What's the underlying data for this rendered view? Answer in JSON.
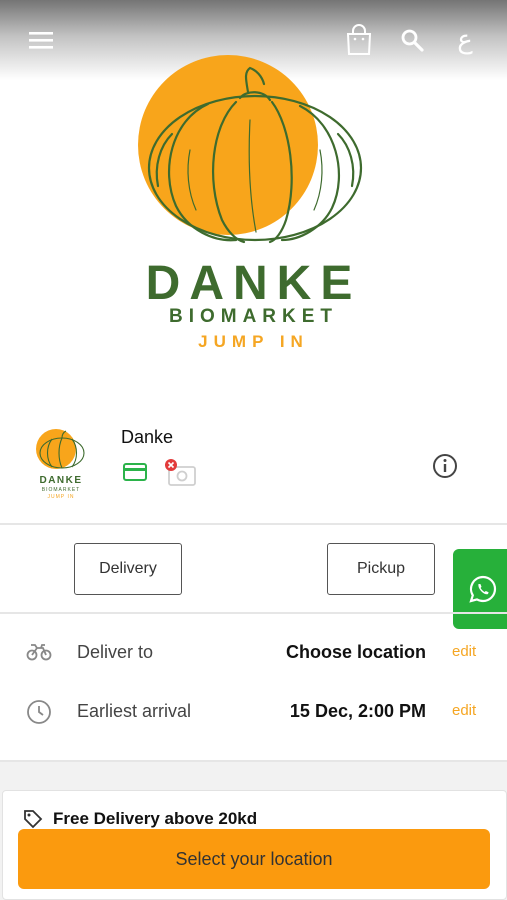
{
  "header": {
    "menu_icon": "hamburger-menu-icon",
    "bag_icon": "shopping-bag-icon",
    "search_icon": "search-icon",
    "language_toggle": "ع"
  },
  "hero": {
    "brand_name": "DANKE",
    "brand_subtitle": "BIOMARKET",
    "brand_tagline": "JUMP IN",
    "logo_circle_color": "#f8a51b",
    "brand_green": "#3e6b2e"
  },
  "store": {
    "name": "Danke",
    "logo_text": "DANKE",
    "logo_sub": "BIOMARKET",
    "logo_tag": "JUMP IN",
    "payment_icons": [
      "credit-card-icon",
      "cash-unavailable-icon"
    ],
    "info_icon": "info-icon"
  },
  "order_mode": {
    "delivery_label": "Delivery",
    "pickup_label": "Pickup"
  },
  "whatsapp": {
    "icon": "whatsapp-icon",
    "color": "#27b03a"
  },
  "details": {
    "deliver_to_label": "Deliver to",
    "deliver_to_value": "Choose location",
    "deliver_to_edit": "edit",
    "arrival_label": "Earliest arrival",
    "arrival_value": "15 Dec, 2:00 PM",
    "arrival_edit": "edit"
  },
  "promo": {
    "text": "Free Delivery above 20kd"
  },
  "cta": {
    "label": "Select your location",
    "color": "#fb9a0e"
  },
  "accent_color": "#f5a623"
}
